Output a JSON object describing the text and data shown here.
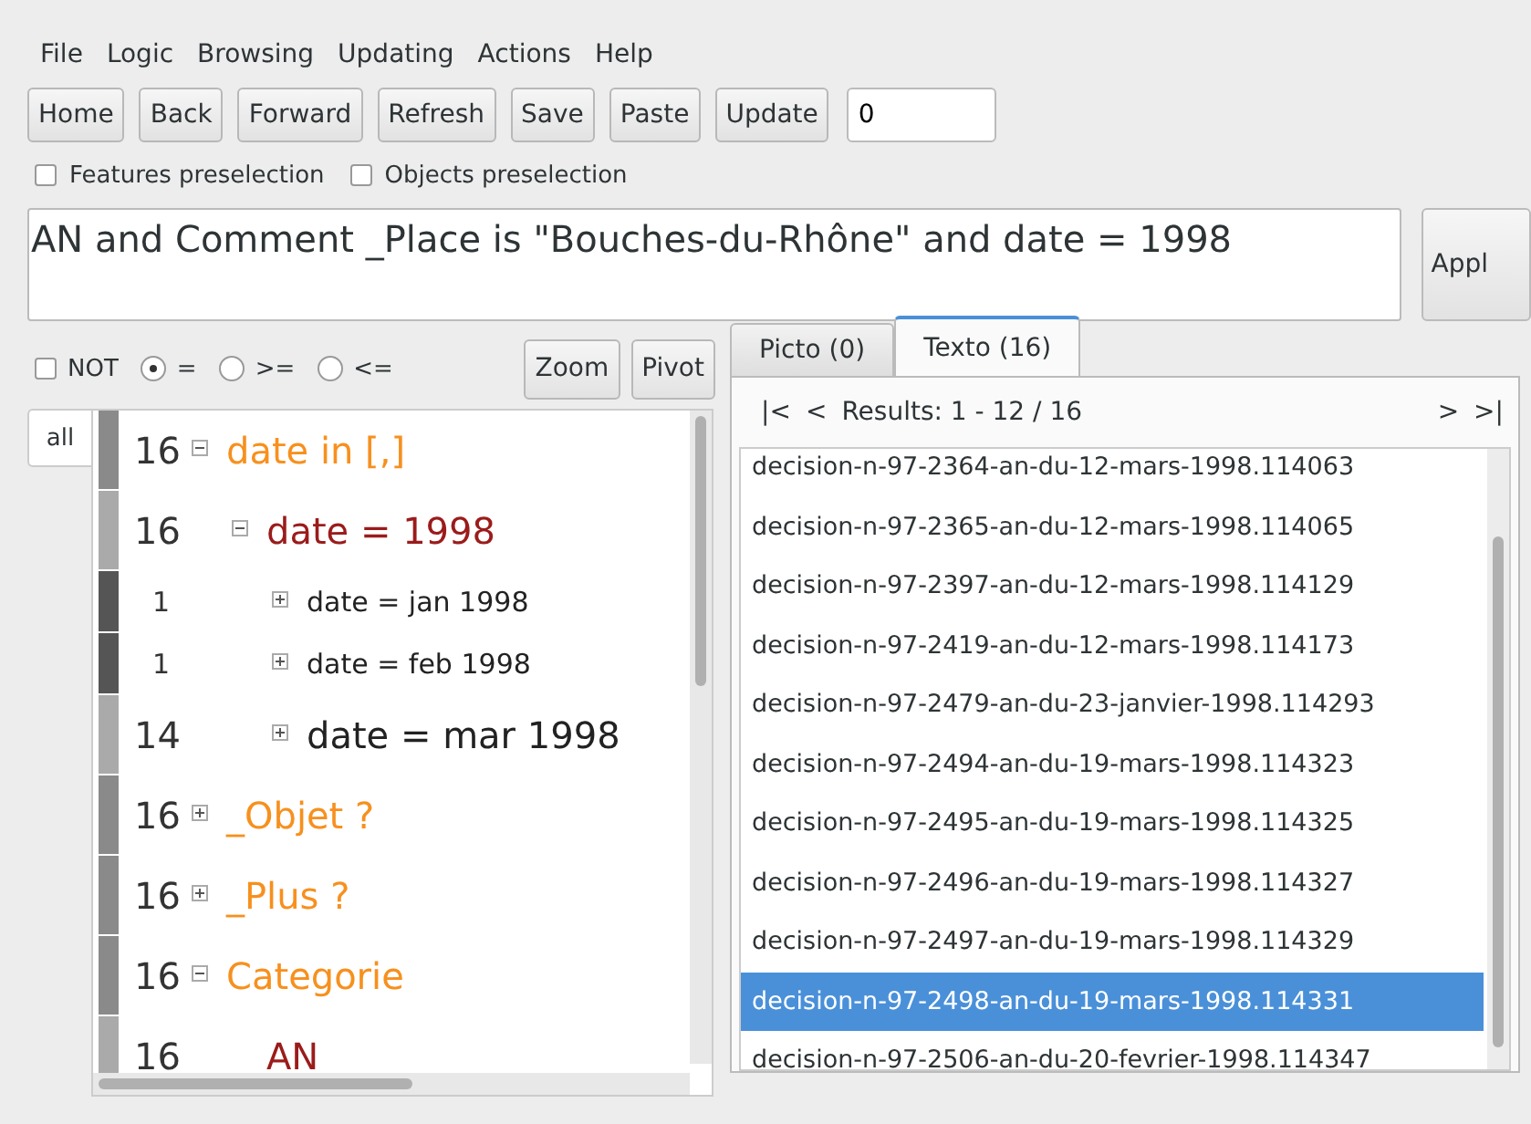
{
  "menu": [
    "File",
    "Logic",
    "Browsing",
    "Updating",
    "Actions",
    "Help"
  ],
  "toolbar": {
    "buttons": [
      "Home",
      "Back",
      "Forward",
      "Refresh",
      "Save",
      "Paste",
      "Update"
    ],
    "field_value": "0"
  },
  "preselection": [
    {
      "label": "Features preselection",
      "checked": false
    },
    {
      "label": "Objects preselection",
      "checked": false
    }
  ],
  "query": {
    "value": "AN and Comment _Place is \"Bouches-du-Rhône\" and date = 1998",
    "apply_button": "Appl"
  },
  "navigation": {
    "not": {
      "label": "NOT",
      "checked": false
    },
    "operators": [
      {
        "label": "=",
        "selected": true
      },
      {
        "label": ">=",
        "selected": false
      },
      {
        "label": "<=",
        "selected": false
      }
    ],
    "buttons": [
      "Zoom",
      "Pivot"
    ]
  },
  "side_tab": "all",
  "tree": [
    {
      "count": "16",
      "label": "date in [,]",
      "kind": "feature",
      "expanded": true,
      "children": [
        {
          "count": "16",
          "label": "date = 1998",
          "kind": "selected",
          "expanded": true,
          "children": [
            {
              "count": "1",
              "label": "date = jan 1998",
              "kind": "value",
              "expanded": false
            },
            {
              "count": "1",
              "label": "date = feb 1998",
              "kind": "value",
              "expanded": false
            },
            {
              "count": "14",
              "label": "date = mar 1998",
              "kind": "value",
              "expanded": false
            }
          ]
        }
      ]
    },
    {
      "count": "16",
      "label": "_Objet ?",
      "kind": "feature",
      "expanded": false
    },
    {
      "count": "16",
      "label": "_Plus ?",
      "kind": "feature",
      "expanded": false
    },
    {
      "count": "16",
      "label": "Categorie",
      "kind": "feature",
      "expanded": true,
      "children": [
        {
          "count": "16",
          "label": "AN",
          "kind": "selected",
          "leaf": true
        }
      ]
    }
  ],
  "results": {
    "tabs": [
      {
        "label": "Picto (0)",
        "selected": false
      },
      {
        "label": "Texto (16)",
        "selected": true
      }
    ],
    "first": "|<",
    "prev": "<",
    "summary": "Results: 1 - 12 / 16",
    "next": ">",
    "last": ">|",
    "items": [
      {
        "label": "decision-n-97-2364-an-du-12-mars-1998.114063",
        "selected": false
      },
      {
        "label": "decision-n-97-2365-an-du-12-mars-1998.114065",
        "selected": false
      },
      {
        "label": "decision-n-97-2397-an-du-12-mars-1998.114129",
        "selected": false
      },
      {
        "label": "decision-n-97-2419-an-du-12-mars-1998.114173",
        "selected": false
      },
      {
        "label": "decision-n-97-2479-an-du-23-janvier-1998.114293",
        "selected": false
      },
      {
        "label": "decision-n-97-2494-an-du-19-mars-1998.114323",
        "selected": false
      },
      {
        "label": "decision-n-97-2495-an-du-19-mars-1998.114325",
        "selected": false
      },
      {
        "label": "decision-n-97-2496-an-du-19-mars-1998.114327",
        "selected": false
      },
      {
        "label": "decision-n-97-2497-an-du-19-mars-1998.114329",
        "selected": false
      },
      {
        "label": "decision-n-97-2498-an-du-19-mars-1998.114331",
        "selected": true
      },
      {
        "label": "decision-n-97-2506-an-du-20-fevrier-1998.114347",
        "selected": false
      }
    ]
  }
}
